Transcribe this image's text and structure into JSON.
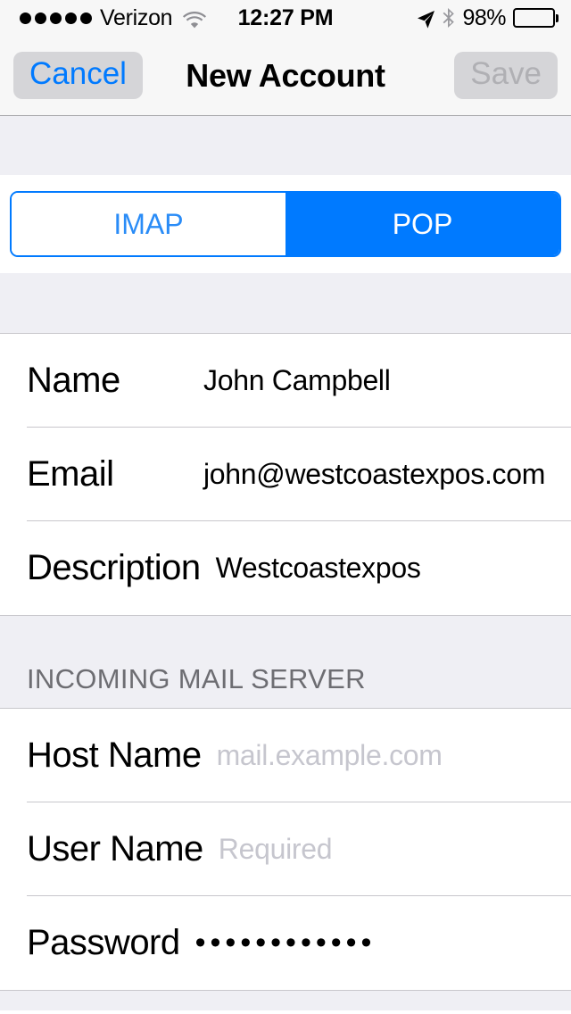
{
  "status_bar": {
    "signal_dots": 5,
    "carrier": "Verizon",
    "wifi_icon": "wifi-icon",
    "time": "12:27 PM",
    "location_icon": "location-arrow-icon",
    "bluetooth_icon": "bluetooth-icon",
    "battery_percent": "98%",
    "battery_level": 98
  },
  "nav_bar": {
    "cancel_label": "Cancel",
    "title": "New Account",
    "save_label": "Save",
    "cancel_color": "#007aff",
    "save_color": "#b0b0b4"
  },
  "segmented_control": {
    "options": [
      {
        "label": "IMAP",
        "selected": false
      },
      {
        "label": "POP",
        "selected": true
      }
    ],
    "accent_color": "#007aff"
  },
  "account_section": {
    "rows": [
      {
        "label": "Name",
        "value": "John Campbell",
        "placeholder": false
      },
      {
        "label": "Email",
        "value": "john@westcoastexpos.com",
        "placeholder": false
      },
      {
        "label": "Description",
        "value": "Westcoastexpos",
        "placeholder": false
      }
    ]
  },
  "incoming_section": {
    "header": "INCOMING MAIL SERVER",
    "rows": [
      {
        "label": "Host Name",
        "value": "mail.example.com",
        "placeholder": true
      },
      {
        "label": "User Name",
        "value": "Required",
        "placeholder": true
      },
      {
        "label": "Password",
        "value": "••••••••••••",
        "placeholder": false
      }
    ]
  },
  "colors": {
    "group_background": "#efeff4",
    "separator": "#c8c7cc",
    "placeholder_text": "#c6c6ce",
    "section_header_text": "#6d6d72",
    "tint": "#007aff"
  }
}
